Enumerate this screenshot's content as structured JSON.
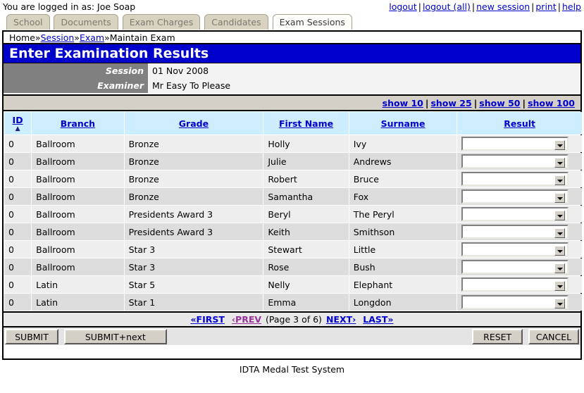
{
  "topbar": {
    "login_text": "You are logged in as: Joe Soap",
    "links": [
      {
        "label": "logout"
      },
      {
        "label": "logout (all)"
      },
      {
        "label": "new session"
      },
      {
        "label": "print"
      },
      {
        "label": "help"
      }
    ],
    "separator": "|"
  },
  "tabs": [
    {
      "label": "School",
      "active": false
    },
    {
      "label": "Documents",
      "active": false
    },
    {
      "label": "Exam Charges",
      "active": false
    },
    {
      "label": "Candidates",
      "active": false
    },
    {
      "label": "Exam Sessions",
      "active": true
    }
  ],
  "breadcrumb": {
    "home": "Home",
    "sep": "»",
    "session": "Session",
    "exam": "Exam",
    "current": "Maintain Exam"
  },
  "page": {
    "title": "Enter Examination Results",
    "title_bg": "#0000cc"
  },
  "info": [
    {
      "label": "Session",
      "value": "01 Nov 2008"
    },
    {
      "label": "Examiner",
      "value": "Mr Easy To Please"
    }
  ],
  "show_links": [
    {
      "label": "show 10"
    },
    {
      "label": "show 25"
    },
    {
      "label": "show 50"
    },
    {
      "label": "show 100"
    }
  ],
  "grid": {
    "columns": [
      {
        "label": "ID",
        "sort": "asc",
        "sort_icon": "sort-ascending-icon"
      },
      {
        "label": "Branch",
        "sort": ""
      },
      {
        "label": "Grade",
        "sort": ""
      },
      {
        "label": "First Name",
        "sort": ""
      },
      {
        "label": "Surname",
        "sort": ""
      },
      {
        "label": "Result",
        "sort": ""
      }
    ],
    "header_bg": "#cceeff",
    "rows": [
      {
        "id": "0",
        "branch": "Ballroom",
        "grade": "Bronze",
        "first_name": "Holly",
        "surname": "Ivy",
        "result": ""
      },
      {
        "id": "0",
        "branch": "Ballroom",
        "grade": "Bronze",
        "first_name": "Julie",
        "surname": "Andrews",
        "result": ""
      },
      {
        "id": "0",
        "branch": "Ballroom",
        "grade": "Bronze",
        "first_name": "Robert",
        "surname": "Bruce",
        "result": ""
      },
      {
        "id": "0",
        "branch": "Ballroom",
        "grade": "Bronze",
        "first_name": "Samantha",
        "surname": "Fox",
        "result": ""
      },
      {
        "id": "0",
        "branch": "Ballroom",
        "grade": "Presidents Award 3",
        "first_name": "Beryl",
        "surname": "The Peryl",
        "result": ""
      },
      {
        "id": "0",
        "branch": "Ballroom",
        "grade": "Presidents Award 3",
        "first_name": "Keith",
        "surname": "Smithson",
        "result": ""
      },
      {
        "id": "0",
        "branch": "Ballroom",
        "grade": "Star 3",
        "first_name": "Stewart",
        "surname": "Little",
        "result": ""
      },
      {
        "id": "0",
        "branch": "Ballroom",
        "grade": "Star 3",
        "first_name": "Rose",
        "surname": "Bush",
        "result": ""
      },
      {
        "id": "0",
        "branch": "Latin",
        "grade": "Star 5",
        "first_name": "Nelly",
        "surname": "Elephant",
        "result": ""
      },
      {
        "id": "0",
        "branch": "Latin",
        "grade": "Star 1",
        "first_name": "Emma",
        "surname": "Longdon",
        "result": ""
      }
    ]
  },
  "pager": {
    "first": "«FIRST",
    "prev": "‹PREV",
    "page_text": "(Page 3 of 6)",
    "next": "NEXT›",
    "last": "LAST»",
    "current_page": 3,
    "total_pages": 6,
    "prev_color": "#993399",
    "link_color": "#0000cc"
  },
  "buttons": {
    "submit": "SUBMIT",
    "submit_next": "SUBMIT+next",
    "reset": "RESET",
    "cancel": "CANCEL"
  },
  "footer": {
    "text": "IDTA Medal Test System"
  }
}
